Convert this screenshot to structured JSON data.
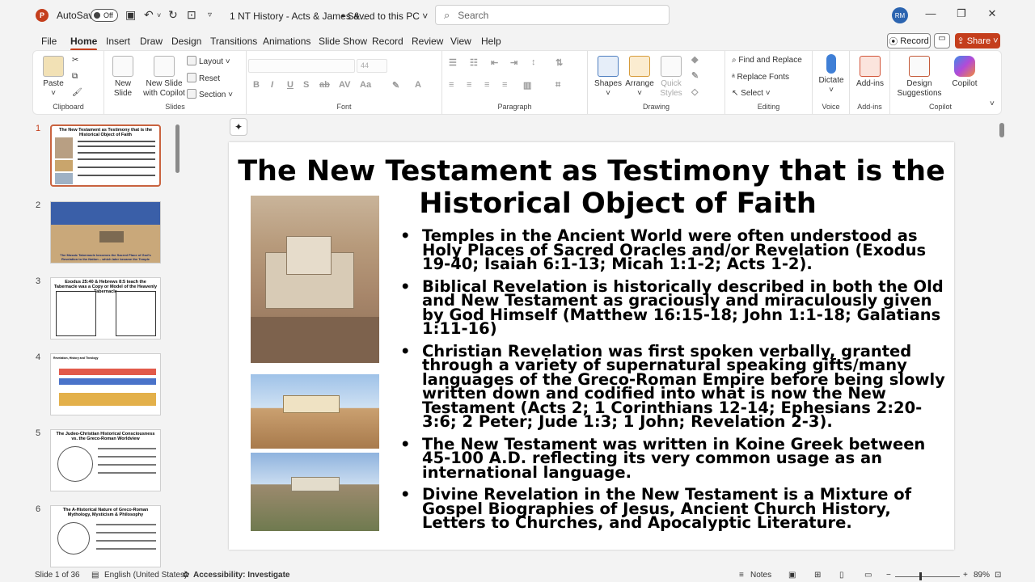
{
  "titlebar": {
    "app_icon": "P",
    "autosave_label": "AutoSave",
    "autosave_state": "Off",
    "doc_title": "1 NT History - Acts & James &...",
    "doc_status": "• Saved to this PC ˅",
    "search_placeholder": "Search",
    "user_initials": "RM",
    "icons": [
      "save-icon",
      "undo-icon",
      "redo-icon",
      "present-icon",
      "customize-icon",
      "minimize-icon",
      "restore-icon",
      "close-icon"
    ]
  },
  "menu": {
    "items": [
      "File",
      "Home",
      "Insert",
      "Draw",
      "Design",
      "Transitions",
      "Animations",
      "Slide Show",
      "Record",
      "Review",
      "View",
      "Help"
    ],
    "active": "Home",
    "record_label": "Record",
    "share_label": "Share"
  },
  "ribbon": {
    "groups": {
      "clipboard": "Clipboard",
      "slides": "Slides",
      "font": "Font",
      "paragraph": "Paragraph",
      "drawing": "Drawing",
      "editing": "Editing",
      "voice": "Voice",
      "addins": "Add-ins",
      "copilot": "Copilot"
    },
    "paste": "Paste",
    "new_slide": "New Slide",
    "new_slide_copilot": "New Slide with Copilot",
    "layout": "Layout",
    "reset": "Reset",
    "section": "Section",
    "font_size": "44",
    "shapes": "Shapes",
    "arrange": "Arrange",
    "quick_styles": "Quick Styles",
    "find_replace": "Find and Replace",
    "replace_fonts": "Replace Fonts",
    "select": "Select",
    "dictate": "Dictate",
    "add_ins": "Add-ins",
    "design_suggestions": "Design Suggestions",
    "copilot": "Copilot",
    "format_buttons": [
      "B",
      "I",
      "U",
      "S",
      "ab",
      "AV",
      "Aa"
    ]
  },
  "thumbnails": [
    {
      "num": "1",
      "title": "The New Testament as Testimony that is the Historical Object of Faith"
    },
    {
      "num": "2",
      "title": "The Mosaic Tabernacle becomes the Sacred Place of God's Revelation to the Nation – which later became the Temple"
    },
    {
      "num": "3",
      "title": "Exodus 25:40 & Hebrews 8:5 teach the Tabernacle was a Copy or Model of the Heavenly Tabernacle"
    },
    {
      "num": "4",
      "title": "Revelation, History and Theology"
    },
    {
      "num": "5",
      "title": "The Judeo-Christian Historical Consciousness vs. the Greco-Roman Worldview"
    },
    {
      "num": "6",
      "title": "The A-Historical Nature of Greco-Roman Mythology, Mysticism & Philosophy"
    }
  ],
  "slide": {
    "title_line1": "The New Testament as Testimony that is the",
    "title_line2": "Historical Object of Faith",
    "bullets": [
      "Temples in the Ancient World were often understood as Holy Places of Sacred Oracles and/or Revelation (Exodus 19-40; Isaiah 6:1-13; Micah 1:1-2; Acts 1-2).",
      "Biblical Revelation is historically described in both the Old and New Testament as graciously and miraculously given by God Himself (Matthew 16:15-18; John 1:1-18; Galatians 1:11-16)",
      "Christian Revelation was first spoken verbally, granted through a variety of supernatural speaking gifts/many languages of the Greco-Roman Empire before being slowly written down and codified into what is now the New Testament (Acts 2; 1 Corinthians 12-14; Ephesians 2:20-3:6; 2 Peter; Jude 1:3; 1 John; Revelation 2-3).",
      "The New Testament was written in Koine Greek between 45-100 A.D. reflecting its very common usage as an international language.",
      "Divine Revelation in the New Testament is a Mixture of Gospel Biographies of Jesus, Ancient Church History, Letters to Churches, and Apocalyptic Literature."
    ]
  },
  "status": {
    "slide_of": "Slide 1 of 36",
    "language": "English (United States)",
    "accessibility": "Accessibility: Investigate",
    "notes": "Notes",
    "zoom": "89%"
  },
  "colors": {
    "accent": "#c43e1c",
    "avatar": "#2b64b0"
  }
}
